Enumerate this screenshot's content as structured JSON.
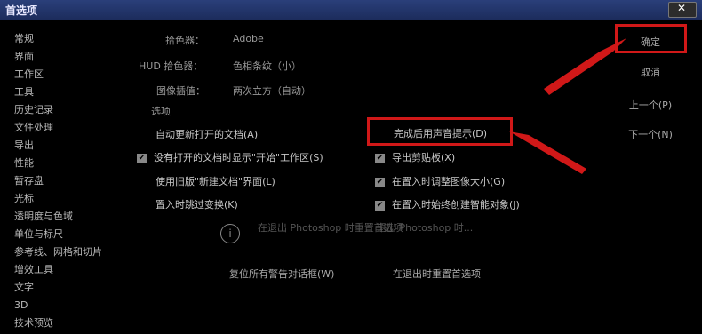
{
  "window": {
    "title": "首选项",
    "close_glyph": "✕"
  },
  "sidebar": {
    "items": [
      "常规",
      "界面",
      "工作区",
      "工具",
      "历史记录",
      "文件处理",
      "导出",
      "性能",
      "暂存盘",
      "光标",
      "透明度与色域",
      "单位与标尺",
      "参考线、网格和切片",
      "增效工具",
      "文字",
      "3D",
      "技术预览"
    ]
  },
  "settings": {
    "row1": {
      "label": "拾色器：",
      "value": "Adobe"
    },
    "row2": {
      "label": "HUD 拾色器：",
      "value": "色相条纹（小）"
    },
    "row3": {
      "label": "图像插值：",
      "value": "两次立方（自动）"
    },
    "section_label": "选项"
  },
  "left_options": [
    {
      "label": "自动更新打开的文档(A)",
      "checked": false
    },
    {
      "label": "没有打开的文档时显示\"开始\"工作区(S)",
      "checked": true
    },
    {
      "label": "使用旧版\"新建文档\"界面(L)",
      "checked": false
    },
    {
      "label": "置入时跳过变换(K)",
      "checked": false
    }
  ],
  "right_options": [
    {
      "label": "完成后用声音提示(D)",
      "checked": false
    },
    {
      "label": "导出剪贴板(X)",
      "checked": true
    },
    {
      "label": "在置入时调整图像大小(G)",
      "checked": true
    },
    {
      "label": "在置入时始终创建智能对象(J)",
      "checked": true
    }
  ],
  "info_text": {
    "left": "在退出 Photoshop 时重置首选项",
    "right": "退出 Photoshop 时..."
  },
  "bottom": {
    "reset_warnings": "复位所有警告对话框(W)",
    "reset_prefs": "在退出时重置首选项"
  },
  "right_buttons": {
    "ok": "确定",
    "cancel": "取消",
    "prev": "上一个(P)",
    "next": "下一个(N)"
  },
  "colors": {
    "titlebar": "#1c2c5c",
    "highlight": "#d01818",
    "background": "#000000"
  }
}
